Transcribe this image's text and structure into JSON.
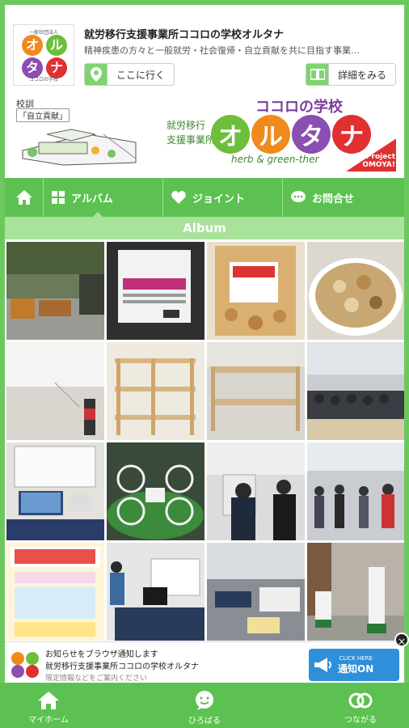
{
  "header": {
    "title": "就労移行支援事業所ココロの学校オルタナ",
    "subtitle": "精神疾患の方々と一般就労・社会復帰・自立貢献を共に目指す事業…",
    "go_button": "ここに行く",
    "more_button": "詳細をみる",
    "logo": {
      "top_text": "一般社団法人",
      "chars": [
        "オ",
        "ル",
        "タ",
        "ナ"
      ],
      "bottom_text": "ココロの学校"
    }
  },
  "banner": {
    "label_school": "校訓",
    "label_motto": "「自立貢献」",
    "kokoro": "ココロの学校",
    "shuro_line1": "就労移行",
    "shuro_line2": "支援事業所",
    "ortana": [
      "オ",
      "ル",
      "タ",
      "ナ"
    ],
    "herb": "herb & green-ther",
    "project_line1": "Project",
    "project_line2": "OMOYA!"
  },
  "nav": {
    "album": "アルバム",
    "joint": "ジョイント",
    "contact": "お問合せ"
  },
  "section_title": "Album",
  "notification": {
    "line1": "お知らせをブラウザ通知します",
    "line2": "就労移行支援事業所ココロの学校オルタナ",
    "line3": "限定情報などをご案内ください",
    "cta_small": "CLICK HERE",
    "cta_big": "通知ON",
    "close": "×"
  },
  "tabbar": {
    "home": "マイホーム",
    "hiroba": "ひろばる",
    "tsunagaru": "つながる"
  },
  "colors": {
    "brand_green": "#5cc150",
    "light_green": "#a8e29b",
    "cta_blue": "#2f8fd8",
    "orange": "#f08a1c",
    "green": "#6cbf3a",
    "purple": "#8a4fb0",
    "red": "#e03030"
  }
}
